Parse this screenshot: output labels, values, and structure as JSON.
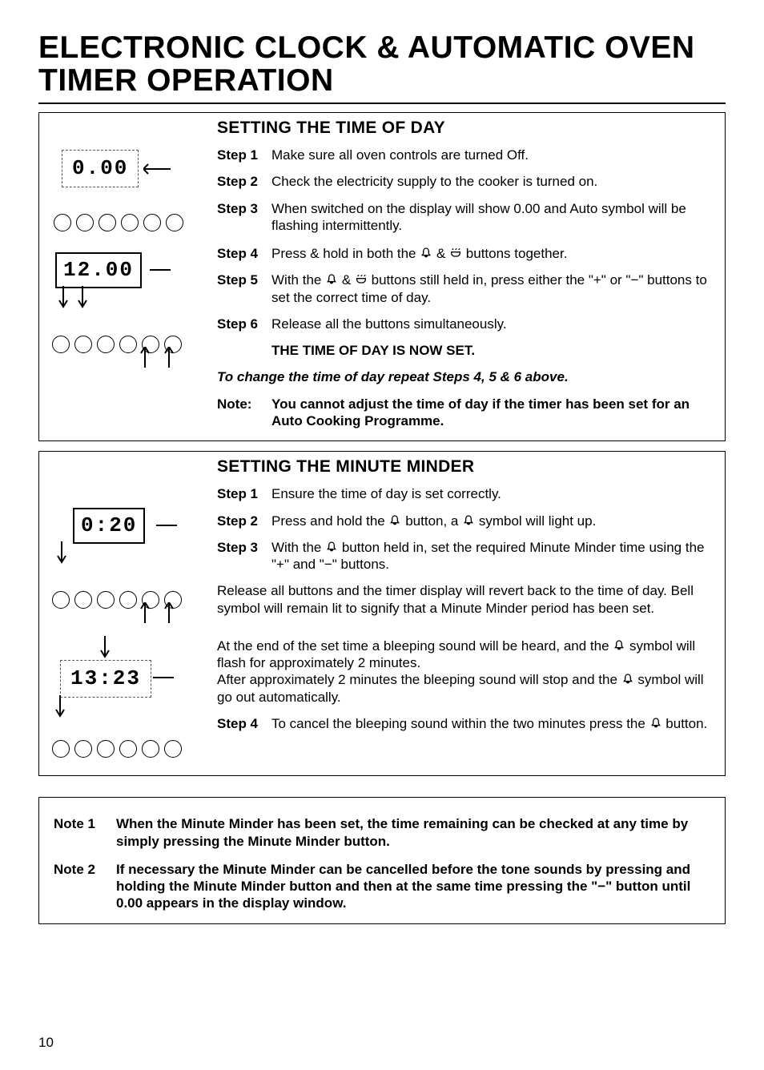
{
  "title": "ELECTRONIC CLOCK & AUTOMATIC OVEN TIMER OPERATION",
  "page_number": "10",
  "section_tod": {
    "heading": "SETTING THE TIME OF DAY",
    "display1": "0.00",
    "display2": "12.00",
    "steps": {
      "s1_label": "Step 1",
      "s1": "Make sure all oven controls are turned Off.",
      "s2_label": "Step 2",
      "s2": "Check the electricity supply to the cooker is turned on.",
      "s3_label": "Step 3",
      "s3": "When switched on the display will show 0.00 and Auto symbol will be flashing intermittently.",
      "s4_label": "Step 4",
      "s4_a": "Press & hold in both the",
      "s4_b": " & ",
      "s4_c": " buttons together.",
      "s5_label": "Step 5",
      "s5_a": "With the",
      "s5_b": "&",
      "s5_c": " buttons still held in, press either the \"+\" or \"−\" buttons to set the correct time of day.",
      "s6_label": "Step 6",
      "s6": "Release all the buttons simultaneously.",
      "now_set": "THE TIME OF DAY IS NOW SET.",
      "repeat": "To change the time of day repeat Steps 4, 5 & 6 above.",
      "note_label": "Note:",
      "note": "You cannot adjust the time of day if the timer has been set for an Auto Cooking Programme."
    }
  },
  "section_mm": {
    "heading": "SETTING THE MINUTE MINDER",
    "display1": "0:20",
    "display2": "13:23",
    "steps": {
      "s1_label": "Step 1",
      "s1": "Ensure the time of day is set correctly.",
      "s2_label": "Step 2",
      "s2_a": "Press and hold the ",
      "s2_b": " button, a",
      "s2_c": " symbol will light up.",
      "s3_label": "Step 3",
      "s3_a": "With the ",
      "s3_b": " button held in, set the required Minute Minder time using the \"+\" and \"−\" buttons.",
      "release": "Release all buttons and the timer display will revert back to the time of day. Bell symbol will remain lit to signify that a Minute Minder period has been set.",
      "end_a": "At the end of the set time a bleeping sound will be heard, and the ",
      "end_b": " symbol will flash for approximately 2 minutes.",
      "end_c": "After approximately 2 minutes the bleeping sound will stop and the ",
      "end_d": " symbol will go out automatically.",
      "s4_label": "Step 4",
      "s4_a": "To cancel the bleeping sound within the two minutes press the ",
      "s4_b": "button."
    }
  },
  "notes": {
    "n1_label": "Note 1",
    "n1": "When the Minute Minder has been set, the time remaining can be checked at any time by simply pressing the Minute Minder button.",
    "n2_label": "Note 2",
    "n2": "If necessary the Minute Minder can be cancelled before the tone sounds by pressing and holding the Minute Minder button and then at the same time pressing the \"−\" button until 0.00 appears in the display window."
  },
  "icons": {
    "bell": "bell-icon",
    "pot": "pot-icon",
    "bell_arrow": "bell-icon"
  }
}
